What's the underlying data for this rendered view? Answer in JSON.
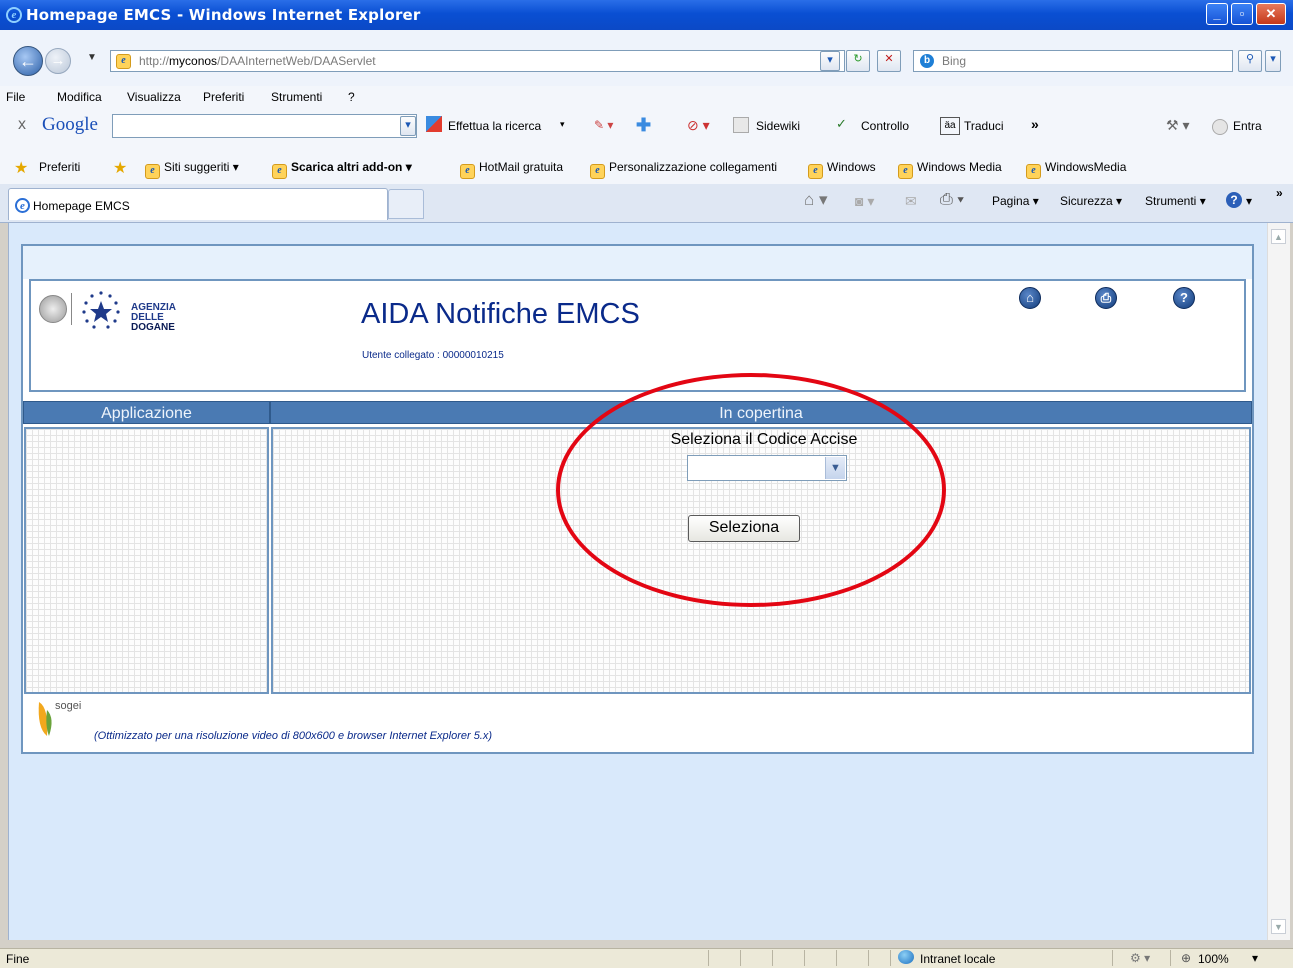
{
  "window": {
    "title": "Homepage EMCS - Windows Internet Explorer"
  },
  "address_bar": {
    "url_host": "http://myconos/",
    "url_host_bold": "myconos",
    "url_path": "DAAInternetWeb/DAAServlet",
    "search_placeholder": "Bing"
  },
  "menu": [
    "File",
    "Modifica",
    "Visualizza",
    "Preferiti",
    "Strumenti",
    "?"
  ],
  "google_toolbar": {
    "close": "x",
    "logo": "Google",
    "search_label": "Effettua la ricerca",
    "sidewiki": "Sidewiki",
    "controllo": "Controllo",
    "traduci": "Traduci",
    "more": "»",
    "entra": "Entra"
  },
  "favorites_bar": {
    "preferiti": "Preferiti",
    "items": [
      "Siti suggeriti",
      "Scarica altri add-on",
      "HotMail gratuita",
      "Personalizzazione collegamenti",
      "Windows",
      "Windows Media",
      "WindowsMedia"
    ]
  },
  "tabs": {
    "active": "Homepage EMCS",
    "tools": [
      "Pagina",
      "Sicurezza",
      "Strumenti"
    ]
  },
  "page": {
    "logo_text": [
      "AGENZIA",
      "DELLE",
      "DOGANE"
    ],
    "title": "AIDA Notifiche EMCS",
    "user_label": "Utente collegato : 00000010215",
    "col_left": "Applicazione",
    "col_right": "In copertina",
    "select_label": "Seleziona il Codice Accise",
    "select_value": "",
    "select_button": "Seleziona",
    "footer_logo": "sogei",
    "footer_note": "(Ottimizzato per una risoluzione video di 800x600 e browser Internet Explorer 5.x)"
  },
  "status_bar": {
    "left": "Fine",
    "zone": "Intranet locale",
    "zoom": "100%"
  },
  "colors": {
    "title_blue": "#0a2a8a",
    "header_blue": "#4a7ab3",
    "annotation_red": "#e30613"
  }
}
